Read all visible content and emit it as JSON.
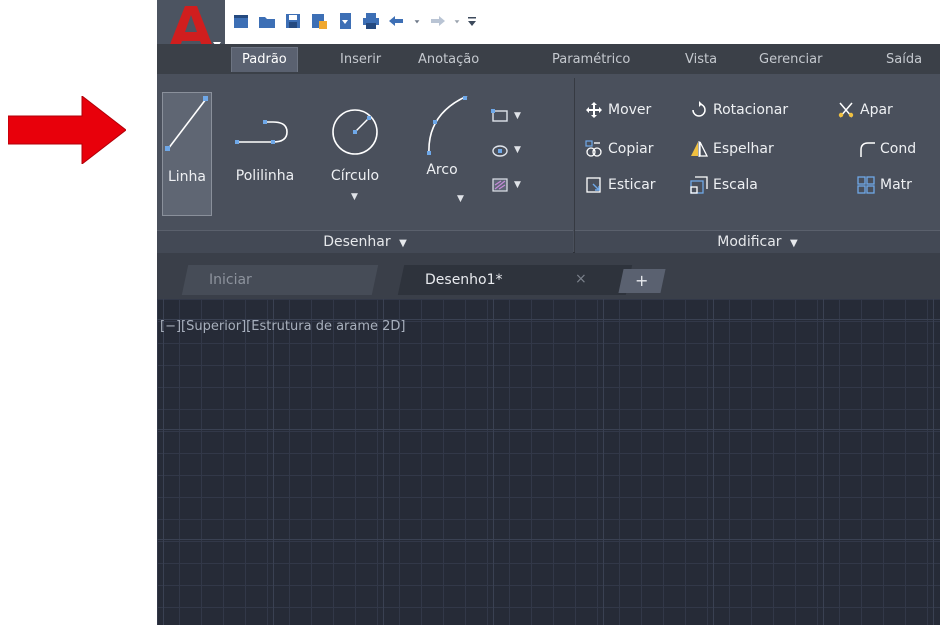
{
  "annotation": {
    "arrow_color": "#e8000b"
  },
  "quick_access": {
    "app_menu_letter": "A",
    "icons": [
      "new-file-icon",
      "open-folder-icon",
      "save-icon",
      "save-as-icon",
      "export-icon",
      "print-icon",
      "undo-icon",
      "undo-dropdown-icon",
      "redo-icon",
      "redo-dropdown-icon",
      "customize-dropdown-icon"
    ]
  },
  "ribbon_tabs": [
    "Padrão",
    "Inserir",
    "Anotação",
    "Paramétrico",
    "Vista",
    "Gerenciar",
    "Saída"
  ],
  "draw_panel": {
    "title": "Desenhar",
    "buttons": {
      "linha": "Linha",
      "polilinha": "Polilinha",
      "circulo": "Círculo",
      "arco": "Arco"
    }
  },
  "modify_panel": {
    "title": "Modificar",
    "buttons": {
      "mover": "Mover",
      "rotacionar": "Rotacionar",
      "aparar": "Apar",
      "copiar": "Copiar",
      "espelhar": "Espelhar",
      "concordancia": "Cond",
      "esticar": "Esticar",
      "escala": "Escala",
      "matriz": "Matr"
    }
  },
  "doc_tabs": {
    "start": "Iniciar",
    "current": "Desenho1*",
    "close_symbol": "×",
    "new_symbol": "+"
  },
  "viewport": {
    "label": "[−][Superior][Estrutura de arame 2D]"
  },
  "colors": {
    "accent": "#d01e1e",
    "viewport_bg": "#262b37",
    "ribbon_bg": "#4a505c"
  }
}
